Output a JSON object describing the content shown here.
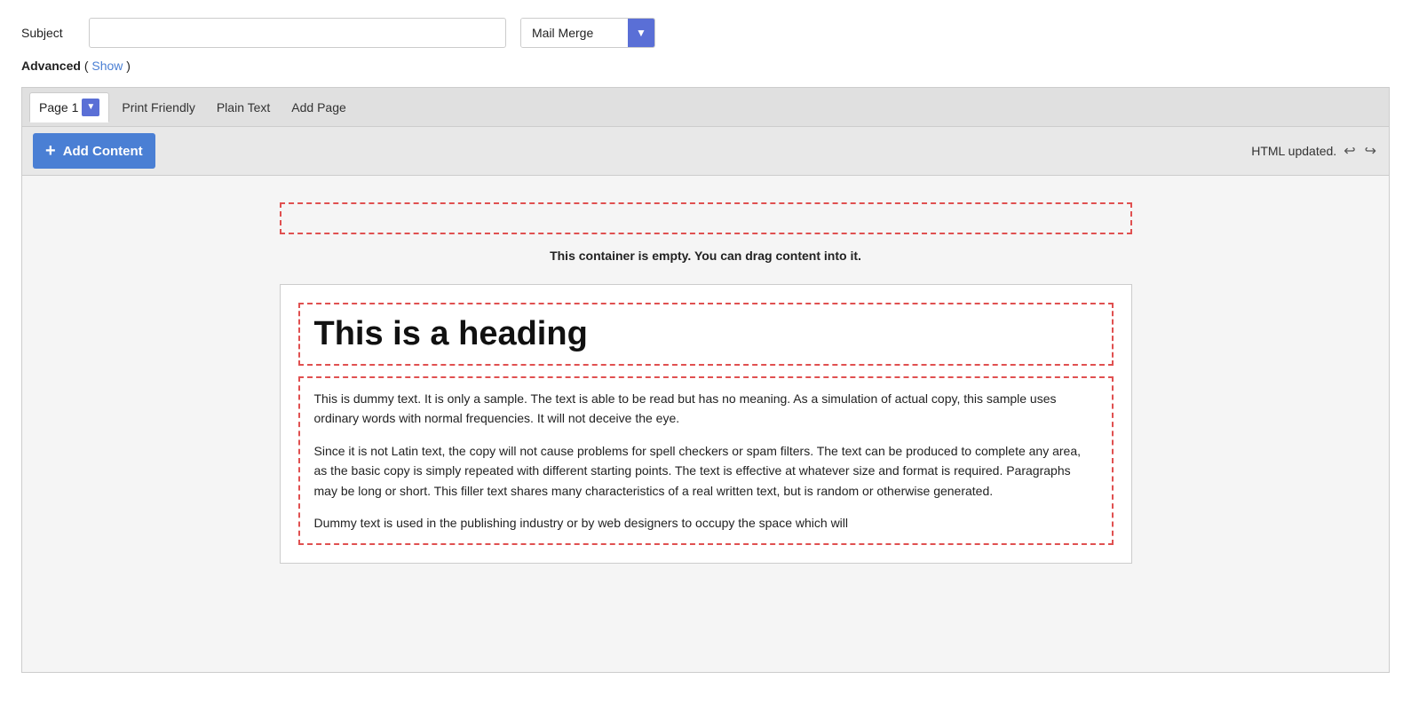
{
  "subject": {
    "label": "Subject",
    "input_value": "",
    "input_placeholder": ""
  },
  "mail_merge": {
    "label": "Mail Merge",
    "dropdown_arrow": "▼"
  },
  "advanced": {
    "label": "Advanced",
    "show_label": "Show"
  },
  "tabs": {
    "page1_label": "Page 1",
    "page1_dropdown": "▼",
    "print_friendly_label": "Print Friendly",
    "plain_text_label": "Plain Text",
    "add_page_label": "Add Page"
  },
  "toolbar": {
    "add_content_label": "Add Content",
    "add_content_plus": "+",
    "html_updated_label": "HTML updated.",
    "undo_icon": "↩",
    "redo_icon": "↪"
  },
  "content": {
    "empty_container_msg": "This container is empty. You can drag content into it.",
    "heading_text": "This is a heading",
    "paragraph1": "This is dummy text. It is only a sample. The text is able to be read but has no meaning. As a simulation of actual copy, this sample uses ordinary words with normal frequencies. It will not deceive the eye.",
    "paragraph2": "Since it is not Latin text, the copy will not cause problems for spell checkers or spam filters. The text can be produced to complete any area, as the basic copy is simply repeated with different starting points. The text is effective at whatever size and format is required. Paragraphs may be long or short. This filler text shares many characteristics of a real written text, but is random or otherwise generated.",
    "paragraph3": "Dummy text is used in the publishing industry or by web designers to occupy the space which will"
  }
}
